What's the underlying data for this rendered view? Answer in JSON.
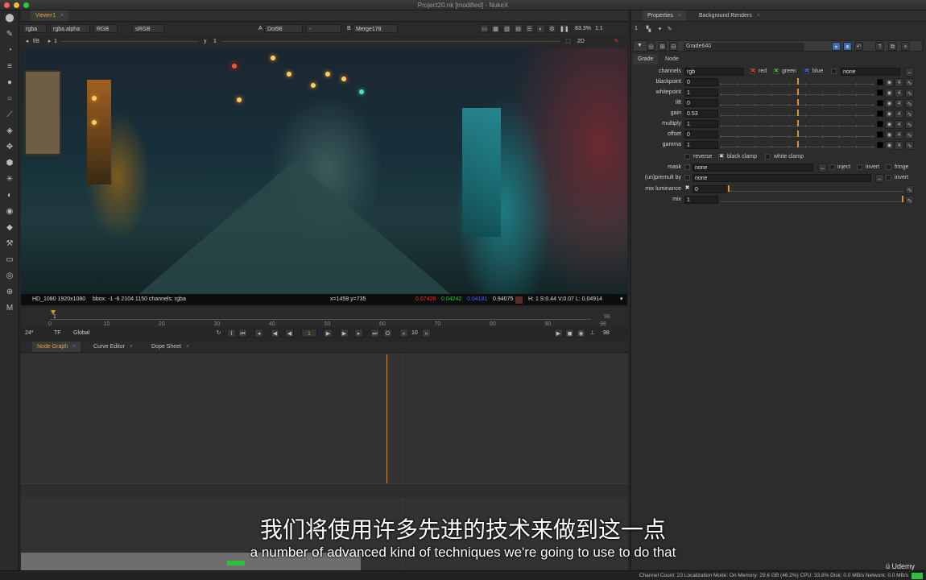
{
  "window": {
    "title": "Project20.nk [modified] - NukeX"
  },
  "toolbar": {
    "icons": [
      "pointer-icon",
      "paint-icon",
      "time-icon",
      "channel-icon",
      "color-icon",
      "filter-icon",
      "keyer-icon",
      "merge-icon",
      "transform-icon",
      "3d-icon",
      "particles-icon",
      "deep-icon",
      "views-icon",
      "metadata-icon",
      "toolsets-icon",
      "other-icon",
      "furnace-icon",
      "ocula-icon",
      "modeler-icon"
    ]
  },
  "viewer": {
    "tab": "Viewer1",
    "channels": "rgba",
    "alpha": "rgba.alpha",
    "display": "RGB",
    "lut": "sRGB",
    "fstop": "f/8",
    "frame_ratio": "1",
    "gain_label": "y",
    "gamma_value": "1",
    "input_a_label": "A",
    "input_a": "Dot96",
    "input_b_label": "B",
    "input_b": "Merge178",
    "zoom": "83.3%",
    "ratio": "1:1",
    "mode": "2D",
    "info": {
      "format": "HD_1080 1920x1080",
      "bbox": "bbox: -1 -6 2104 1150 channels: rgba",
      "coords": "x=1459 y=735",
      "r": "0.07426",
      "g": "0.04242",
      "b": "0.04181",
      "a": "0.94075",
      "hsvl": "H: 1 S:0.44 V:0.07  L: 0.04914"
    }
  },
  "timeline": {
    "start": "1",
    "end": "98",
    "end2": "98",
    "ticks": [
      "0",
      "10",
      "20",
      "30",
      "40",
      "50",
      "60",
      "70",
      "80",
      "90",
      "98"
    ],
    "fps": "24*",
    "tf": "TF",
    "range": "Global",
    "current_frame": "1",
    "step": "10"
  },
  "panels": {
    "tabs": [
      "Node Graph",
      "Curve Editor",
      "Dope Sheet"
    ]
  },
  "properties": {
    "tabs": [
      "Properties",
      "Background Renders"
    ],
    "node_name": "Grade640",
    "subtabs": [
      "Grade",
      "Node"
    ],
    "channels": {
      "label": "channels",
      "value": "rgb",
      "red": "red",
      "green": "green",
      "blue": "blue",
      "extra": "none"
    },
    "knobs": [
      {
        "label": "blackpoint",
        "value": "0"
      },
      {
        "label": "whitepoint",
        "value": "1"
      },
      {
        "label": "lift",
        "value": "0"
      },
      {
        "label": "gain",
        "value": "0.53"
      },
      {
        "label": "multiply",
        "value": "1"
      },
      {
        "label": "offset",
        "value": "0"
      },
      {
        "label": "gamma",
        "value": "1"
      }
    ],
    "reverse": "reverse",
    "black_clamp": "black clamp",
    "white_clamp": "white clamp",
    "mask": {
      "label": "mask",
      "value": "none",
      "inject": "inject",
      "invert": "invert",
      "fringe": "fringe"
    },
    "unpremult": {
      "label": "(un)premult by",
      "value": "none",
      "invert": "invert"
    },
    "mix_luminance": {
      "label": "mix luminance",
      "value": "0"
    },
    "mix": {
      "label": "mix",
      "value": "1"
    },
    "badge": "4"
  },
  "subtitles": {
    "cn": "我们将使用许多先进的技术来做到这一点",
    "en": "a number of advanced kind of techniques we're going to use to do that"
  },
  "status": "Channel Count: 23  Localization Mode: On  Memory: 29.6 GB (46.2%)  CPU: 33.8%  Disk: 0.0 MB/s  Network: 0.0 MB/s",
  "watermark": "Udemy",
  "colors": {
    "accent": "#f0a030",
    "red": "#e03030",
    "green": "#30c030",
    "blue": "#4060ff"
  }
}
